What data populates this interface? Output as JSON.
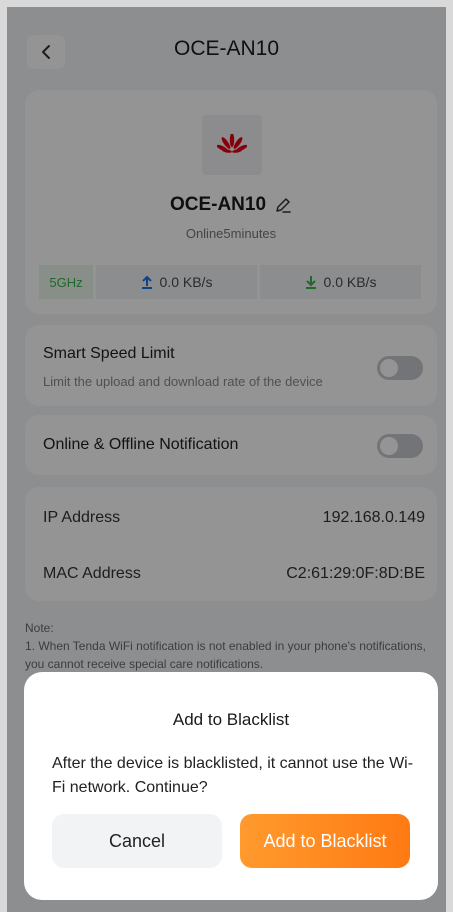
{
  "header": {
    "title": "OCE-AN10"
  },
  "device": {
    "name": "OCE-AN10",
    "status": "Online5minutes",
    "band": "5GHz",
    "upload_rate": "0.0 KB/s",
    "download_rate": "0.0 KB/s",
    "logo_icon": "huawei-logo-icon"
  },
  "speed_limit": {
    "title": "Smart Speed Limit",
    "subtitle": "Limit the upload and download rate of the device",
    "enabled": false
  },
  "notification": {
    "title": "Online & Offline Notification",
    "enabled": false
  },
  "info": [
    {
      "label": "IP Address",
      "value": "192.168.0.149"
    },
    {
      "label": "MAC Address",
      "value": "C2:61:29:0F:8D:BE"
    }
  ],
  "note": {
    "title": "Note:",
    "line1": "1. When Tenda WiFi notification is not enabled in your phone's notifications, you cannot receive special care notifications."
  },
  "dialog": {
    "title": "Add to Blacklist",
    "message": "After the device is blacklisted, it cannot use the Wi-Fi network. Continue?",
    "cancel_label": "Cancel",
    "confirm_label": "Add to Blacklist"
  },
  "colors": {
    "accent": "#ff8a1f",
    "band_green": "#37b34a",
    "arrow_blue": "#1a73e8",
    "arrow_green": "#37b34a"
  }
}
